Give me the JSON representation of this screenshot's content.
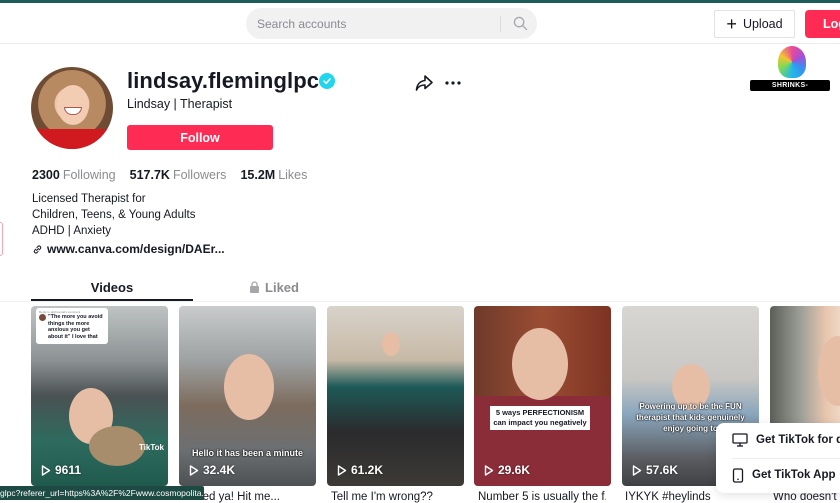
{
  "header": {
    "search_placeholder": "Search accounts",
    "upload_label": "Upload",
    "login_label": "Log in"
  },
  "watermark": {
    "label": "SHRINKS-OFFICE.COM"
  },
  "profile": {
    "username": "lindsay.fleminglpc",
    "verified": true,
    "display_name": "Lindsay | Therapist",
    "follow_label": "Follow",
    "stats": {
      "following_value": "2300",
      "following_label": "Following",
      "followers_value": "517.7K",
      "followers_label": "Followers",
      "likes_value": "15.2M",
      "likes_label": "Likes"
    },
    "bio": [
      "Licensed Therapist for",
      "Children, Teens, & Young Adults",
      "ADHD | Anxiety"
    ],
    "link": "www.canva.com/design/DAEr..."
  },
  "tabs": {
    "videos": "Videos",
    "liked": "Liked"
  },
  "videos": [
    {
      "views": "9611",
      "caption": "",
      "overlay": "",
      "comment_reply_header": "Reply to allybosmal's comment",
      "comment_quote": "\"The more you avoid things the more anxious you get about it\" I love that",
      "watermark": "TikTok"
    },
    {
      "views": "32.4K",
      "caption": "missed ya! Hit me...",
      "overlay": "Hello it has been a minute"
    },
    {
      "views": "61.2K",
      "caption": "Tell me I'm wrong??",
      "overlay": ""
    },
    {
      "views": "29.6K",
      "caption": "Number 5 is usually the f...",
      "overlay": "5 ways PERFECTIONISM can impact you negatively"
    },
    {
      "views": "57.6K",
      "caption": "IYKYK #heylinds",
      "overlay": "Powering up to be the FUN therapist that kids genuinely enjoy going to"
    },
    {
      "views": "",
      "caption": "Who doesn't l...",
      "overlay": ""
    }
  ],
  "status_bar": {
    "url": "glpc?referer_url=https%3A%2F%2Fwww.cosmopolita..."
  },
  "app_popup": {
    "desktop_label": "Get TikTok for desktop",
    "app_label": "Get TikTok App"
  },
  "colors": {
    "brand_red": "#fe2c55",
    "verified_blue": "#20d5ec",
    "text_primary": "#161823",
    "text_secondary": "#8a8b91"
  }
}
